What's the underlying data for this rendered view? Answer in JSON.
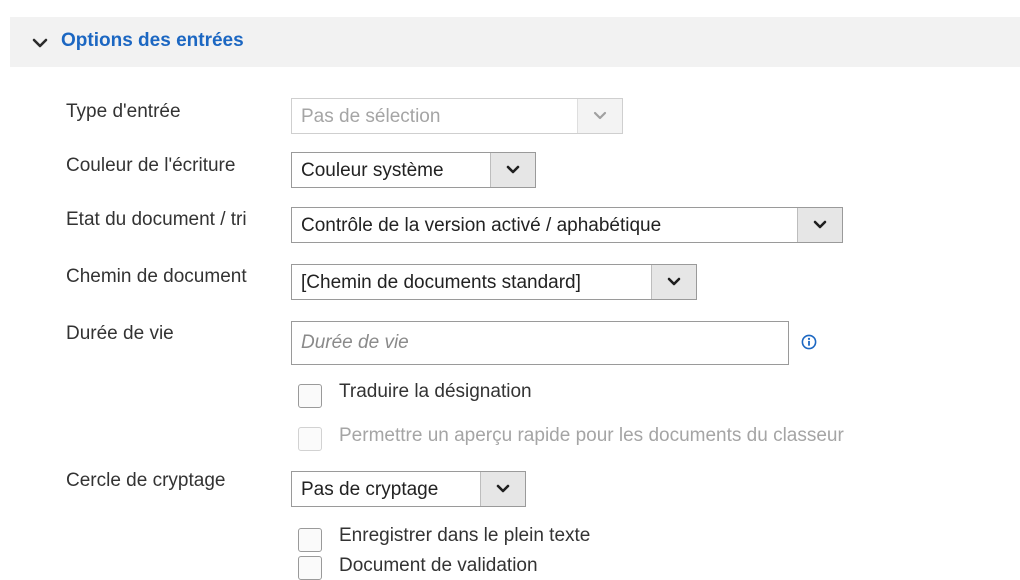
{
  "section": {
    "title": "Options des entrées",
    "icon": "chevron-down-icon"
  },
  "fields": {
    "entry_type": {
      "label": "Type d'entrée",
      "value": "Pas de sélection",
      "disabled": true
    },
    "text_color": {
      "label": "Couleur de l'écriture",
      "value": "Couleur système"
    },
    "doc_state": {
      "label": "Etat du document / tri",
      "value": "Contrôle de la version activé / aphabétique"
    },
    "doc_path": {
      "label": "Chemin de document",
      "value": "[Chemin de documents standard]"
    },
    "lifetime": {
      "label": "Durée de vie",
      "placeholder": "Durée de vie",
      "value": ""
    },
    "encryption": {
      "label": "Cercle de cryptage",
      "value": "Pas de cryptage"
    }
  },
  "checkboxes": {
    "translate": {
      "label": "Traduire la désignation",
      "checked": false,
      "disabled": false
    },
    "quick_preview": {
      "label": "Permettre un aperçu rapide pour les documents du classeur",
      "checked": false,
      "disabled": true
    },
    "fulltext": {
      "label": "Enregistrer dans le plein texte",
      "checked": false,
      "disabled": false
    },
    "validation": {
      "label": "Document de validation",
      "checked": false,
      "disabled": false
    }
  },
  "colors": {
    "accent": "#1c67c2",
    "header_bg": "#f2f2f2",
    "select_button_bg": "#e6e6e6"
  }
}
